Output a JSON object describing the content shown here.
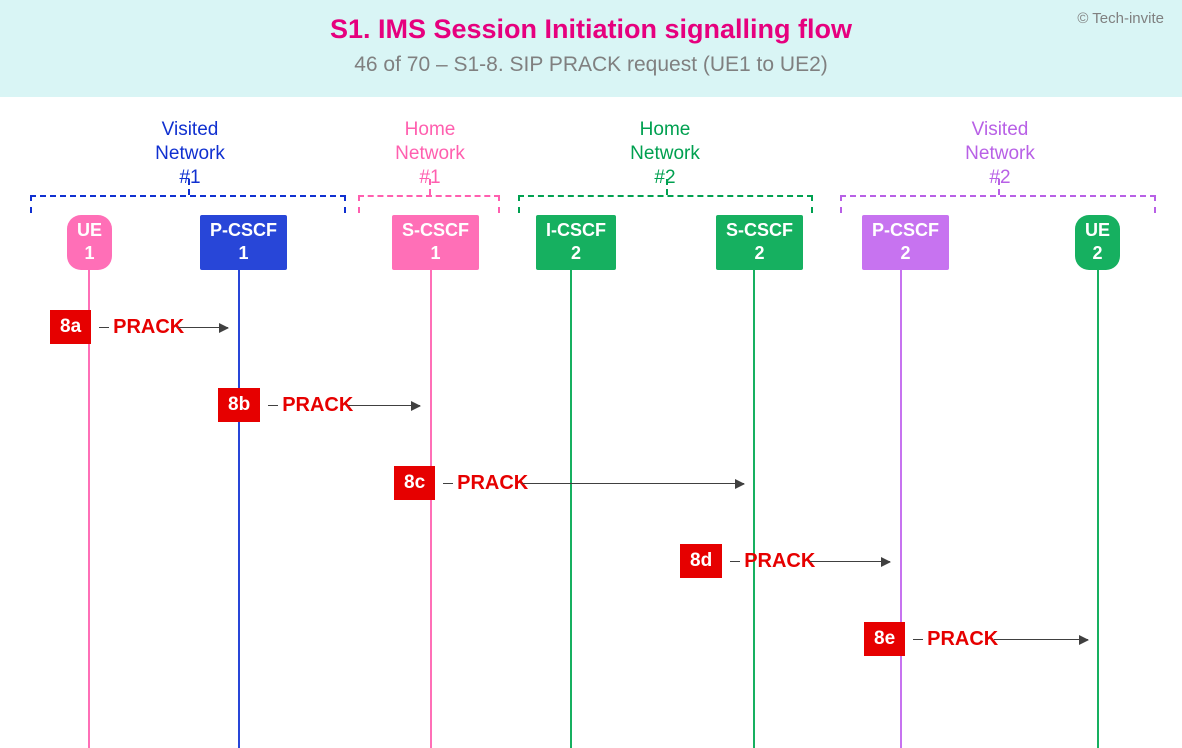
{
  "header": {
    "copyright": "© Tech-invite",
    "title": "S1. IMS Session Initiation signalling flow",
    "subtitle": "46 of 70 – S1-8. SIP PRACK request (UE1 to UE2)"
  },
  "networks": {
    "visited1": {
      "line1": "Visited",
      "line2": "Network",
      "line3": "#1",
      "color": "#1030d0"
    },
    "home1": {
      "line1": "Home",
      "line2": "Network",
      "line3": "#1",
      "color": "#ff5faf"
    },
    "home2": {
      "line1": "Home",
      "line2": "Network",
      "line3": "#2",
      "color": "#00a050"
    },
    "visited2": {
      "line1": "Visited",
      "line2": "Network",
      "line3": "#2",
      "color": "#b860e6"
    }
  },
  "nodes": {
    "ue1": {
      "line1": "UE",
      "line2": "1",
      "bg": "#ff6fb7",
      "lifeline": "#ff6fb7"
    },
    "pcscf1": {
      "line1": "P-CSCF",
      "line2": "1",
      "bg": "#2846d8",
      "lifeline": "#2846d8"
    },
    "scscf1": {
      "line1": "S-CSCF",
      "line2": "1",
      "bg": "#ff6fb7",
      "lifeline": "#ff6fb7"
    },
    "icscf2": {
      "line1": "I-CSCF",
      "line2": "2",
      "bg": "#16b060",
      "lifeline": "#16b060"
    },
    "scscf2": {
      "line1": "S-CSCF",
      "line2": "2",
      "bg": "#16b060",
      "lifeline": "#16b060"
    },
    "pcscf2": {
      "line1": "P-CSCF",
      "line2": "2",
      "bg": "#c773f0",
      "lifeline": "#c773f0"
    },
    "ue2": {
      "line1": "UE",
      "line2": "2",
      "bg": "#16b060",
      "lifeline": "#16b060"
    }
  },
  "messages": {
    "m8a": {
      "tag": "8a",
      "text": "PRACK"
    },
    "m8b": {
      "tag": "8b",
      "text": "PRACK"
    },
    "m8c": {
      "tag": "8c",
      "text": "PRACK"
    },
    "m8d": {
      "tag": "8d",
      "text": "PRACK"
    },
    "m8e": {
      "tag": "8e",
      "text": "PRACK"
    }
  }
}
